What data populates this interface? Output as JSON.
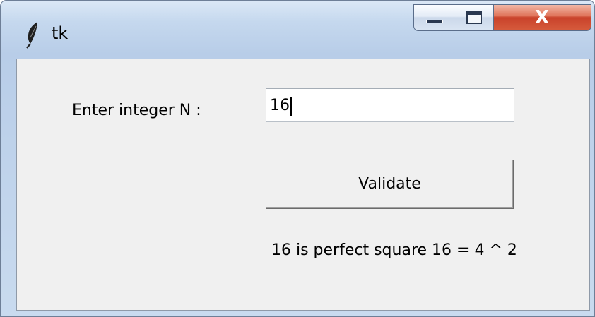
{
  "window": {
    "title": "tk",
    "icon": "feather-icon",
    "controls": {
      "minimize_icon": "minimize-icon",
      "maximize_icon": "maximize-icon",
      "close_label": "X"
    }
  },
  "form": {
    "n_label": "Enter integer N :",
    "n_value": "16",
    "validate_label": "Validate",
    "result_text": "16 is perfect square 16 = 4 ^ 2"
  },
  "colors": {
    "client_bg": "#f0f0f0",
    "close_button": "#c9422a",
    "titlebar": "#c5d8ee"
  }
}
